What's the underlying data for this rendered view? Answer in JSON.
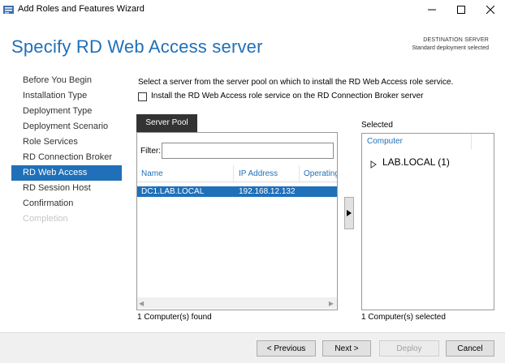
{
  "window": {
    "title": "Add Roles and Features Wizard"
  },
  "header": {
    "title": "Specify RD Web Access server",
    "destination_label": "DESTINATION SERVER",
    "destination_value": "Standard deployment selected"
  },
  "nav": {
    "items": [
      {
        "label": "Before You Begin",
        "state": "normal"
      },
      {
        "label": "Installation Type",
        "state": "normal"
      },
      {
        "label": "Deployment Type",
        "state": "normal"
      },
      {
        "label": "Deployment Scenario",
        "state": "normal"
      },
      {
        "label": "Role Services",
        "state": "normal"
      },
      {
        "label": "RD Connection Broker",
        "state": "normal"
      },
      {
        "label": "RD Web Access",
        "state": "active"
      },
      {
        "label": "RD Session Host",
        "state": "normal"
      },
      {
        "label": "Confirmation",
        "state": "normal"
      },
      {
        "label": "Completion",
        "state": "disabled"
      }
    ]
  },
  "main": {
    "instruction": "Select a server from the server pool on which to install the RD Web Access role service.",
    "checkbox_label": "Install the RD Web Access role service on the RD Connection Broker server",
    "checkbox_checked": false
  },
  "pool": {
    "tab_label": "Server Pool",
    "filter_label": "Filter:",
    "filter_value": "",
    "columns": [
      "Name",
      "IP Address",
      "Operating"
    ],
    "rows": [
      {
        "name": "DC1.LAB.LOCAL",
        "ip": "192.168.12.132",
        "os": ""
      }
    ],
    "status": "1 Computer(s) found"
  },
  "selected": {
    "heading": "Selected",
    "column": "Computer",
    "tree_item": "LAB.LOCAL (1)",
    "status": "1 Computer(s) selected"
  },
  "footer": {
    "previous": "< Previous",
    "next": "Next >",
    "deploy": "Deploy",
    "cancel": "Cancel"
  },
  "colors": {
    "accent": "#1f70b9",
    "dark_tab": "#333333",
    "footer_bg": "#f0f0f0"
  },
  "icons": {
    "app": "server-manager-icon",
    "minimize": "minimize-icon",
    "maximize": "maximize-icon",
    "close": "close-icon",
    "tree": "triangle-right-icon",
    "add": "play-arrow-icon"
  }
}
